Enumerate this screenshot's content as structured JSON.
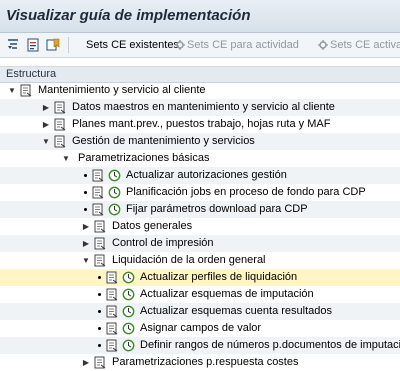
{
  "window": {
    "title": "Visualizar guía de implementación"
  },
  "toolbar": {
    "icons": [
      "structure-expand-icon",
      "document-icon",
      "bookmark-icon",
      "settings-icon"
    ],
    "buttons": [
      {
        "label": "Sets CE existentes",
        "enabled": true
      },
      {
        "label": "Sets CE para actividad",
        "enabled": false
      },
      {
        "label": "Sets CE activa",
        "enabled": false
      }
    ]
  },
  "tree": {
    "header": "Estructura",
    "rows": [
      {
        "label": "Mantenimiento y servicio al cliente"
      },
      {
        "label": "Datos maestros en mantenimiento y servicio al cliente"
      },
      {
        "label": "Planes mant.prev., puestos trabajo, hojas ruta y MAF"
      },
      {
        "label": "Gestión de mantenimiento y servicios"
      },
      {
        "label": "Parametrizaciones básicas"
      },
      {
        "label": "Actualizar autorizaciones gestión"
      },
      {
        "label": "Planificación jobs en proceso de fondo para CDP"
      },
      {
        "label": "Fijar parámetros download para CDP"
      },
      {
        "label": "Datos generales"
      },
      {
        "label": "Control de impresión"
      },
      {
        "label": "Liquidación de la orden general"
      },
      {
        "label": "Actualizar perfiles de liquidación"
      },
      {
        "label": "Actualizar esquemas de imputación"
      },
      {
        "label": "Actualizar esquemas cuenta resultados"
      },
      {
        "label": "Asignar campos de valor"
      },
      {
        "label": "Definir rangos de números p.documentos de imputació"
      },
      {
        "label": "Parametrizaciones p.respuesta costes"
      }
    ]
  },
  "colors": {
    "selected_row": "#fff5c6",
    "alt_row": "#f0f3f6",
    "exec_icon": "#3d8a2c"
  }
}
